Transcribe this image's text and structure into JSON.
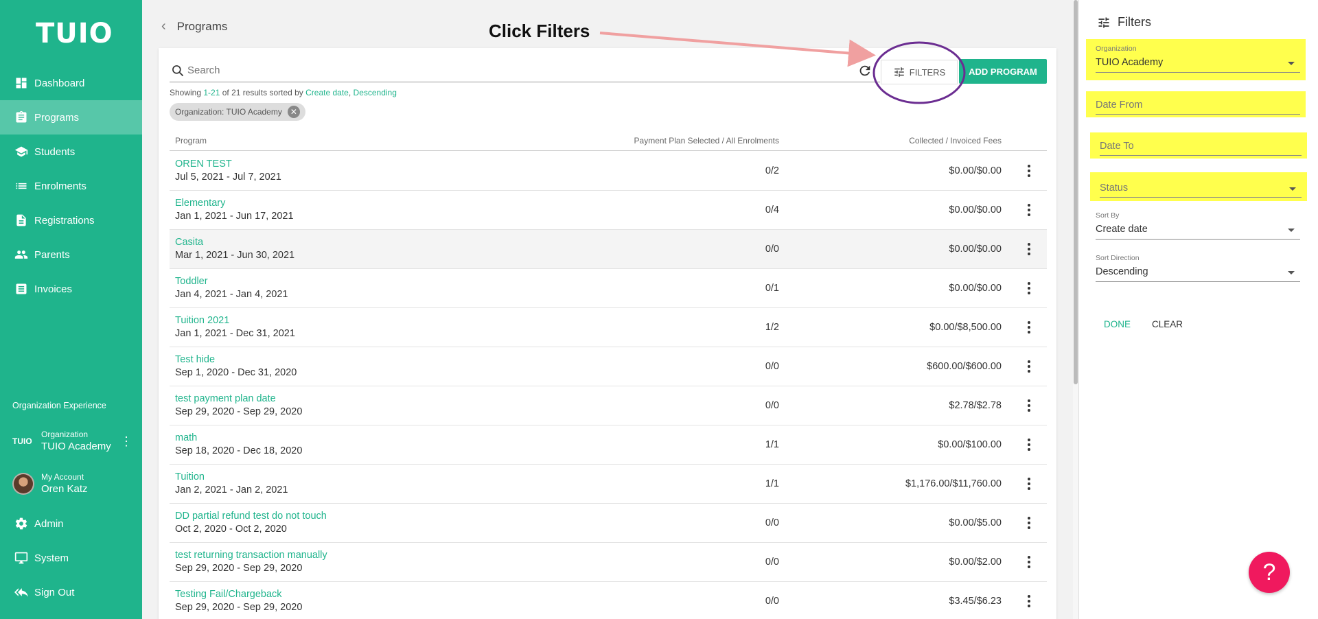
{
  "sidebar": {
    "logo": "TUIO",
    "nav": [
      {
        "label": "Dashboard",
        "icon": "dashboard-icon"
      },
      {
        "label": "Programs",
        "icon": "clipboard-icon",
        "active": true
      },
      {
        "label": "Students",
        "icon": "school-icon"
      },
      {
        "label": "Enrolments",
        "icon": "list-icon"
      },
      {
        "label": "Registrations",
        "icon": "document-icon"
      },
      {
        "label": "Parents",
        "icon": "people-icon"
      },
      {
        "label": "Invoices",
        "icon": "receipt-icon"
      }
    ],
    "section_label": "Organization Experience",
    "org": {
      "logo": "TUIO",
      "sub": "Organization",
      "name": "TUIO Academy"
    },
    "account": {
      "sub": "My Account",
      "name": "Oren Katz"
    },
    "bottom": [
      {
        "label": "Admin",
        "icon": "gear-icon"
      },
      {
        "label": "System",
        "icon": "monitor-icon"
      },
      {
        "label": "Sign Out",
        "icon": "sign-out-icon"
      }
    ]
  },
  "header": {
    "title": "Programs"
  },
  "toolbar": {
    "search_placeholder": "Search",
    "filters_label": "FILTERS",
    "add_label": "ADD PROGRAM"
  },
  "results": {
    "prefix": "Showing ",
    "range": "1-21",
    "middle": " of 21 results sorted by ",
    "sort": "Create date",
    "comma": ", ",
    "direction": "Descending"
  },
  "chip": {
    "label": "Organization: TUIO Academy"
  },
  "table": {
    "headers": {
      "program": "Program",
      "plan": "Payment Plan Selected / All Enrolments",
      "fees": "Collected / Invoiced Fees"
    },
    "rows": [
      {
        "name": "OREN TEST",
        "dates": "Jul 5, 2021 - Jul 7, 2021",
        "plan": "0/2",
        "fees": "$0.00/$0.00"
      },
      {
        "name": "Elementary",
        "dates": "Jan 1, 2021 - Jun 17, 2021",
        "plan": "0/4",
        "fees": "$0.00/$0.00"
      },
      {
        "name": "Casita",
        "dates": "Mar 1, 2021 - Jun 30, 2021",
        "plan": "0/0",
        "fees": "$0.00/$0.00",
        "hl": true
      },
      {
        "name": "Toddler",
        "dates": "Jan 4, 2021 - Jan 4, 2021",
        "plan": "0/1",
        "fees": "$0.00/$0.00"
      },
      {
        "name": "Tuition 2021",
        "dates": "Jan 1, 2021 - Dec 31, 2021",
        "plan": "1/2",
        "fees": "$0.00/$8,500.00"
      },
      {
        "name": "Test hide",
        "dates": "Sep 1, 2020 - Dec 31, 2020",
        "plan": "0/0",
        "fees": "$600.00/$600.00"
      },
      {
        "name": "test payment plan date",
        "dates": "Sep 29, 2020 - Sep 29, 2020",
        "plan": "0/0",
        "fees": "$2.78/$2.78"
      },
      {
        "name": "math",
        "dates": "Sep 18, 2020 - Dec 18, 2020",
        "plan": "1/1",
        "fees": "$0.00/$100.00"
      },
      {
        "name": "Tuition",
        "dates": "Jan 2, 2021 - Jan 2, 2021",
        "plan": "1/1",
        "fees": "$1,176.00/$11,760.00"
      },
      {
        "name": "DD partial refund test do not touch",
        "dates": "Oct 2, 2020 - Oct 2, 2020",
        "plan": "0/0",
        "fees": "$0.00/$5.00"
      },
      {
        "name": "test returning transaction manually",
        "dates": "Sep 29, 2020 - Sep 29, 2020",
        "plan": "0/0",
        "fees": "$0.00/$2.00"
      },
      {
        "name": "Testing Fail/Chargeback",
        "dates": "Sep 29, 2020 - Sep 29, 2020",
        "plan": "0/0",
        "fees": "$3.45/$6.23"
      }
    ]
  },
  "filters_panel": {
    "title": "Filters",
    "organization_label": "Organization",
    "organization_value": "TUIO Academy",
    "date_from": "Date From",
    "date_to": "Date To",
    "status": "Status",
    "sort_by_label": "Sort By",
    "sort_by_value": "Create date",
    "sort_dir_label": "Sort Direction",
    "sort_dir_value": "Descending",
    "done": "DONE",
    "clear": "CLEAR"
  },
  "help_label": "?",
  "annotation": {
    "text": "Click Filters"
  },
  "colors": {
    "brand": "#1fb48c",
    "highlight": "#ffff4d",
    "help": "#f0195e",
    "circle": "#6b2d91",
    "arrow": "#f0a0a0"
  }
}
